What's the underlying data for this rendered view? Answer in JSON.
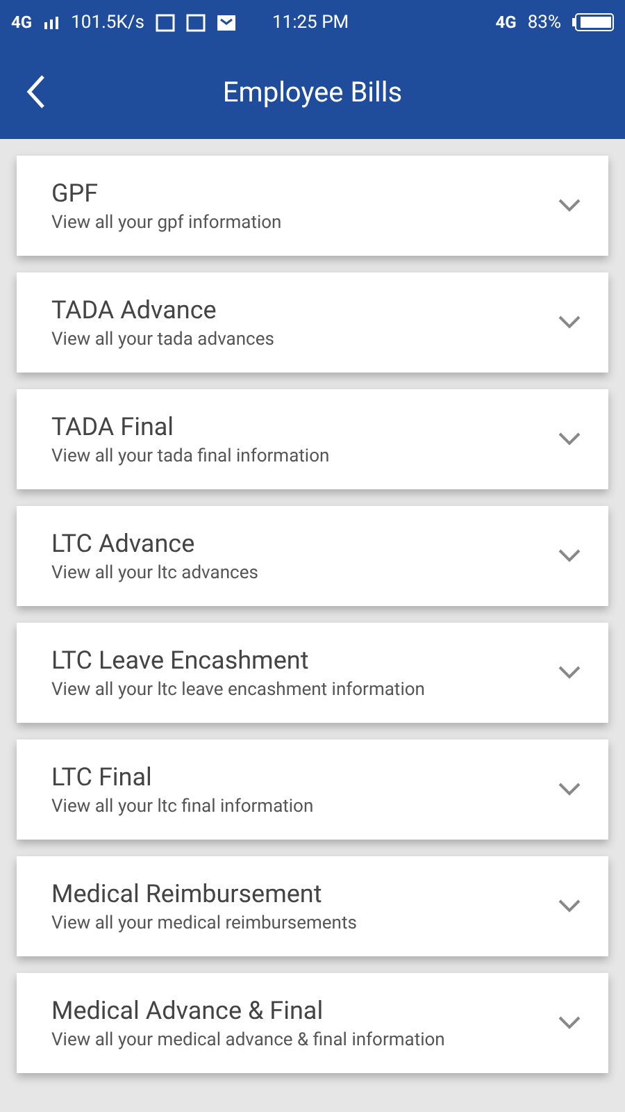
{
  "status_bar": {
    "network": "4G",
    "speed": "101.5K/s",
    "time": "11:25 PM",
    "data_type": "4G",
    "battery": "83%"
  },
  "header": {
    "title": "Employee Bills"
  },
  "items": [
    {
      "title": "GPF",
      "subtitle": "View all your gpf information",
      "expanded": false
    },
    {
      "title": "TADA Advance",
      "subtitle": "View all your tada advances",
      "expanded": false
    },
    {
      "title": "TADA Final",
      "subtitle": "View all your tada final information",
      "expanded": false
    },
    {
      "title": "LTC Advance",
      "subtitle": "View all your ltc advances",
      "expanded": false
    },
    {
      "title": "LTC Leave Encashment",
      "subtitle": "View all your ltc leave encashment information",
      "expanded": false
    },
    {
      "title": "LTC Final",
      "subtitle": "View all your ltc final information",
      "expanded": false
    },
    {
      "title": "Medical Reimbursement",
      "subtitle": "View all your medical reimbursements",
      "expanded": false
    },
    {
      "title": "Medical Advance & Final",
      "subtitle": "View all your medical advance & final information",
      "expanded": false
    }
  ]
}
